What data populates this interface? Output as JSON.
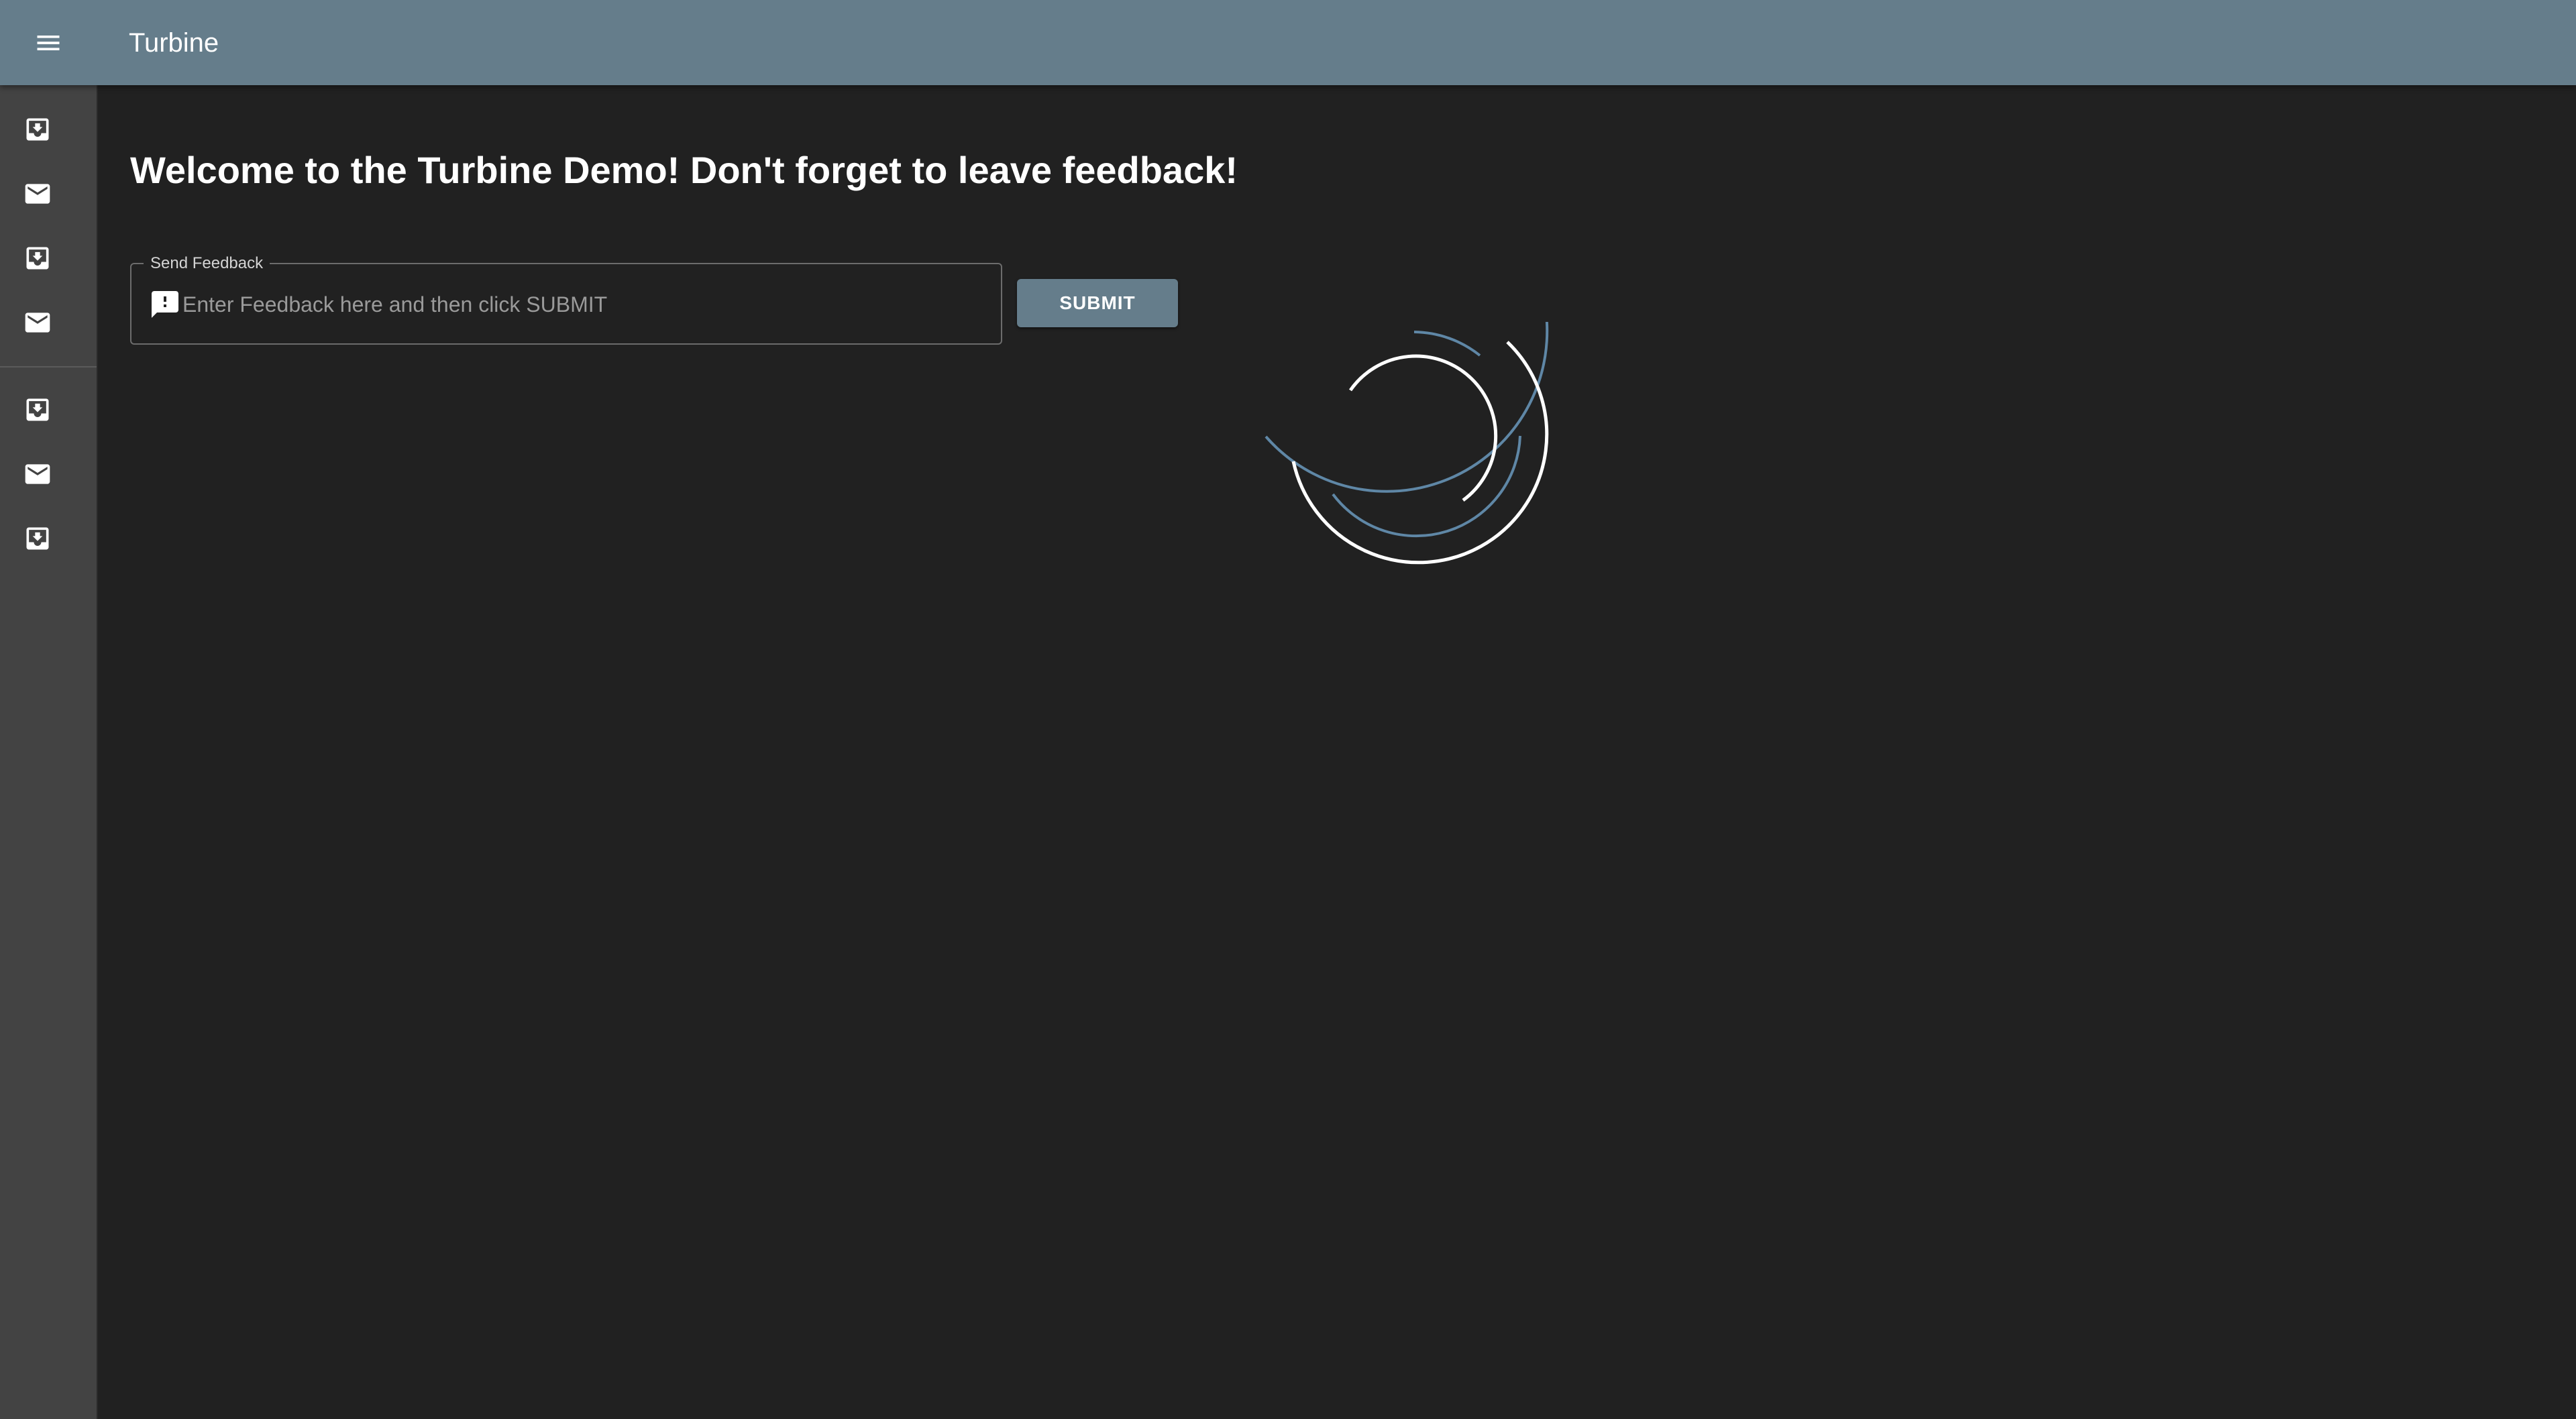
{
  "appbar": {
    "title": "Turbine",
    "background_color": "#657d8b",
    "menu_icon": "menu-icon"
  },
  "drawer": {
    "items": [
      {
        "icon": "move-to-inbox-icon"
      },
      {
        "icon": "mail-icon"
      },
      {
        "icon": "move-to-inbox-icon"
      },
      {
        "icon": "mail-icon"
      },
      {
        "icon": "move-to-inbox-icon"
      },
      {
        "icon": "mail-icon"
      },
      {
        "icon": "move-to-inbox-icon"
      }
    ]
  },
  "main": {
    "headline": "Welcome to the Turbine Demo! Don't forget to leave feedback!",
    "feedback": {
      "label": "Send Feedback",
      "placeholder": "Enter Feedback here and then click SUBMIT",
      "value": "",
      "icon": "feedback-icon"
    },
    "submit_label": "SUBMIT",
    "loading_indicator": "loading-spinner",
    "colors": {
      "background": "#212121",
      "accent": "#5f87a6"
    }
  }
}
